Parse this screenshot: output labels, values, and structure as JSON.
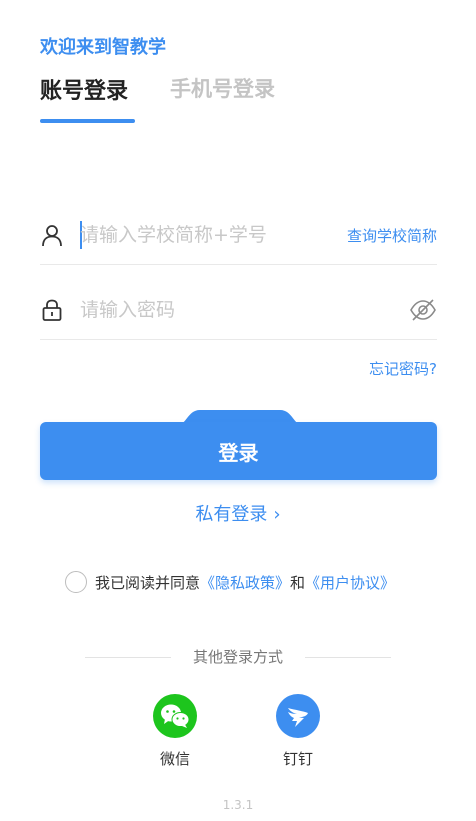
{
  "welcome": "欢迎来到智教学",
  "tabs": [
    {
      "label": "账号登录",
      "active": true
    },
    {
      "label": "手机号登录",
      "active": false
    }
  ],
  "account_field": {
    "placeholder": "请输入学校简称+学号",
    "value": "",
    "icon": "user-icon",
    "link": "查询学校简称"
  },
  "password_field": {
    "placeholder": "请输入密码",
    "value": "",
    "icon": "lock-icon",
    "toggle_icon": "eye-off-icon"
  },
  "forgot_password": "忘记密码?",
  "login_button": "登录",
  "private_login": "私有登录",
  "agreement": {
    "checked": false,
    "prefix": "我已阅读并同意",
    "privacy_link": "《隐私政策》",
    "conjunction": "和",
    "terms_link": "《用户协议》"
  },
  "other_login": {
    "label": "其他登录方式",
    "methods": [
      {
        "name": "微信",
        "icon": "wechat-icon",
        "color": "#1dc51d"
      },
      {
        "name": "钉钉",
        "icon": "dingtalk-icon",
        "color": "#3d8ef0"
      }
    ]
  },
  "version": "1.3.1",
  "colors": {
    "accent": "#3d8ef0",
    "text": "#222222",
    "muted": "#c4c4c4"
  }
}
